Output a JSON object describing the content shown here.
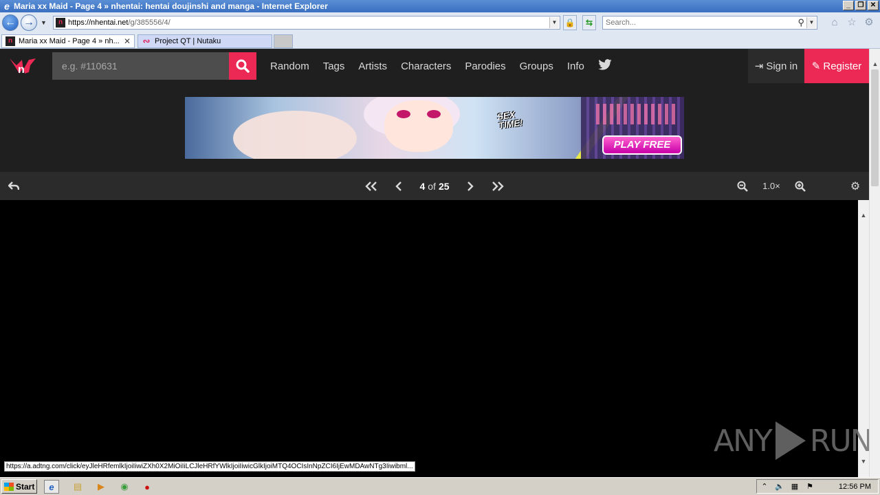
{
  "window": {
    "title": "Maria xx Maid - Page 4 » nhentai: hentai doujinshi and manga - Internet Explorer",
    "minimize_label": "_",
    "restore_label": "❐",
    "close_label": "✕"
  },
  "browser": {
    "url_host": "https://nhentai.net",
    "url_path": "/g/385556/4/",
    "search_placeholder": "Search...",
    "tabs": [
      {
        "label": "Maria xx Maid - Page 4 » nh...",
        "close": "✕"
      },
      {
        "label": "Project QT | Nutaku"
      }
    ]
  },
  "site": {
    "search_placeholder": "e.g. #110631",
    "menu": [
      "Random",
      "Tags",
      "Artists",
      "Characters",
      "Parodies",
      "Groups",
      "Info"
    ],
    "signin_label": "Sign in",
    "register_label": "Register",
    "brand_color": "#ec2854"
  },
  "ad": {
    "tagline_1": "SEX",
    "tagline_2": "TIME!",
    "cta": "PLAY FREE"
  },
  "reader": {
    "current_page": "4",
    "of_label": "of",
    "total_pages": "25",
    "zoom": "1.0×"
  },
  "status_bar": {
    "url": "https://a.adtng.com/click/eyJleHRfemlkIjoiIiwiZXh0X2MiOiIiLCJleHRfYWlkIjoiIiwicGlkIjoiMTQ4OCIsInNpZCI6IjEwMDAwNTg3Iiwibml..."
  },
  "watermark": {
    "left": "ANY",
    "right": "RUN"
  },
  "taskbar": {
    "start_label": "Start",
    "time": "12:56 PM"
  }
}
